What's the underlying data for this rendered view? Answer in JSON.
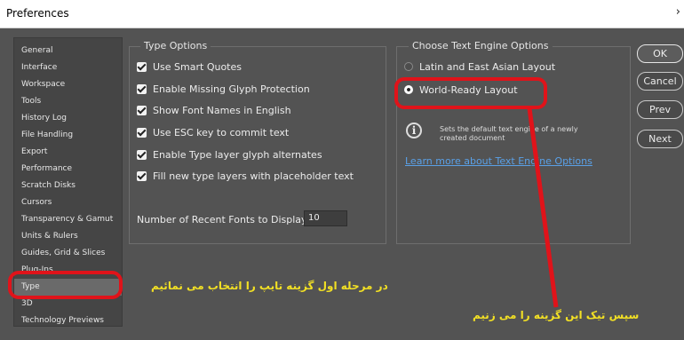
{
  "window": {
    "title": "Preferences",
    "close_glyph": "›"
  },
  "sidebar": {
    "items": [
      {
        "label": "General"
      },
      {
        "label": "Interface"
      },
      {
        "label": "Workspace"
      },
      {
        "label": "Tools"
      },
      {
        "label": "History Log"
      },
      {
        "label": "File Handling"
      },
      {
        "label": "Export"
      },
      {
        "label": "Performance"
      },
      {
        "label": "Scratch Disks"
      },
      {
        "label": "Cursors"
      },
      {
        "label": "Transparency & Gamut"
      },
      {
        "label": "Units & Rulers"
      },
      {
        "label": "Guides, Grid & Slices"
      },
      {
        "label": "Plug-Ins"
      },
      {
        "label": "Type",
        "selected": true
      },
      {
        "label": "3D"
      },
      {
        "label": "Technology Previews"
      }
    ]
  },
  "type_options": {
    "legend": "Type Options",
    "checkboxes": [
      {
        "label": "Use Smart Quotes",
        "checked": true
      },
      {
        "label": "Enable Missing Glyph Protection",
        "checked": true
      },
      {
        "label": "Show Font Names in English",
        "checked": true
      },
      {
        "label": "Use ESC key to commit text",
        "checked": true
      },
      {
        "label": "Enable Type layer glyph alternates",
        "checked": true
      },
      {
        "label": "Fill new type layers with placeholder text",
        "checked": true
      }
    ],
    "recent_fonts_label": "Number of Recent Fonts to Display:",
    "recent_fonts_value": "10"
  },
  "engine_options": {
    "legend": "Choose Text Engine Options",
    "radios": [
      {
        "label": "Latin and East Asian Layout",
        "selected": false
      },
      {
        "label": "World-Ready Layout",
        "selected": true
      }
    ],
    "info_text": "Sets the default text engine of a newly created document",
    "info_glyph": "i",
    "link": "Learn more about Text Engine Options"
  },
  "buttons": {
    "ok": "OK",
    "cancel": "Cancel",
    "prev": "Prev",
    "next": "Next"
  },
  "annotations": {
    "note_type": "در مرحله اول گزینه تایپ را انتخاب می نمائیم",
    "note_engine": "سپس تیک این گزینه را می زنیم",
    "highlight_color": "#e0131a",
    "note_color": "#f2e024"
  }
}
